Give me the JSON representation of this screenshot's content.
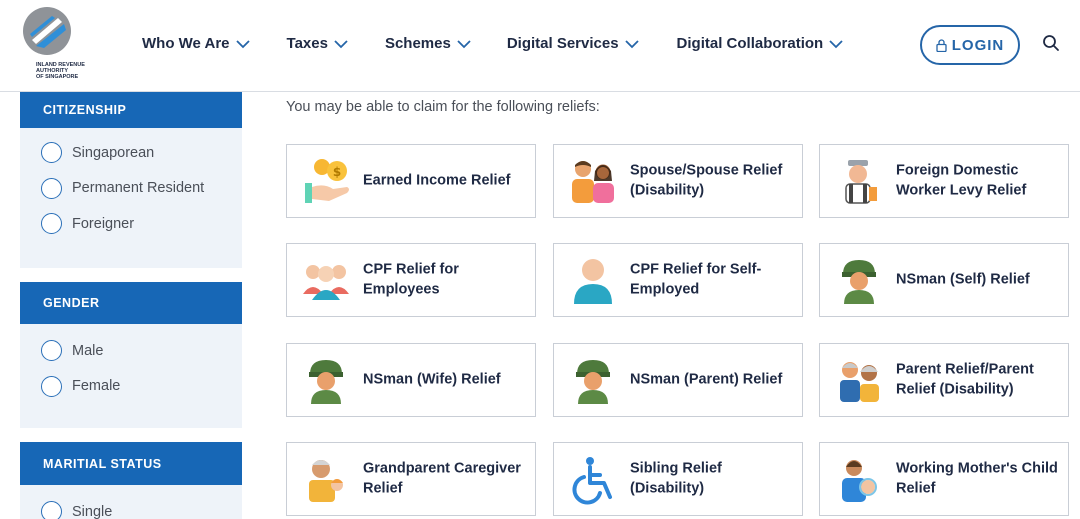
{
  "header": {
    "logo_text": "INLAND REVENUE\nAUTHORITY\nOF SINGAPORE",
    "nav": [
      {
        "label": "Who We Are"
      },
      {
        "label": "Taxes"
      },
      {
        "label": "Schemes"
      },
      {
        "label": "Digital Services"
      },
      {
        "label": "Digital Collaboration"
      }
    ],
    "login_label": "LOGIN"
  },
  "filters": {
    "citizenship": {
      "title": "CITIZENSHIP",
      "options": [
        "Singaporean",
        "Permanent Resident",
        "Foreigner"
      ]
    },
    "gender": {
      "title": "GENDER",
      "options": [
        "Male",
        "Female"
      ]
    },
    "marital_status": {
      "title": "MARITIAL STATUS",
      "options": [
        "Single"
      ]
    }
  },
  "main": {
    "intro": "You may be able to claim for the following reliefs:",
    "reliefs": [
      {
        "label": "Earned Income Relief",
        "icon": "coins-hand-icon"
      },
      {
        "label": "Spouse/Spouse Relief (Disability)",
        "icon": "couple-icon"
      },
      {
        "label": "Foreign Domestic Worker Levy Relief",
        "icon": "domestic-worker-icon"
      },
      {
        "label": "CPF Relief for Employees",
        "icon": "employees-group-icon"
      },
      {
        "label": "CPF Relief for Self-Employed",
        "icon": "person-icon"
      },
      {
        "label": "NSman (Self) Relief",
        "icon": "soldier-icon"
      },
      {
        "label": "NSman (Wife) Relief",
        "icon": "soldier-icon"
      },
      {
        "label": "NSman (Parent) Relief",
        "icon": "soldier-icon"
      },
      {
        "label": "Parent Relief/Parent Relief (Disability)",
        "icon": "elderly-couple-icon"
      },
      {
        "label": "Grandparent Caregiver Relief",
        "icon": "grandparent-child-icon"
      },
      {
        "label": "Sibling Relief (Disability)",
        "icon": "wheelchair-icon"
      },
      {
        "label": "Working Mother's Child Relief",
        "icon": "mother-baby-icon"
      }
    ]
  },
  "colors": {
    "primary": "#1767b6",
    "sidebar_bg": "#eef3f9",
    "text": "#1f2a44",
    "login_border": "#2565a8"
  }
}
